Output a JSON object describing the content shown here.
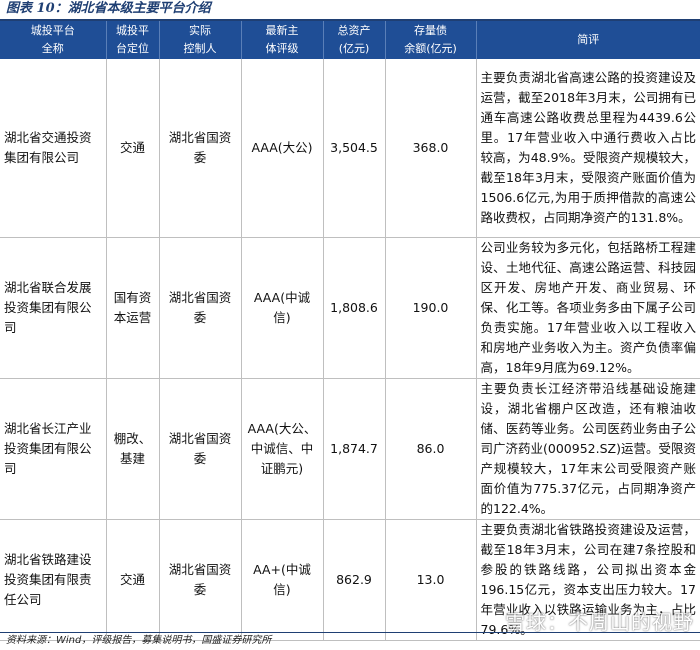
{
  "title": "图表 10：湖北省本级主要平台介绍",
  "headers": [
    "城投平台\n全称",
    "城投平\n台定位",
    "实际\n控制人",
    "最新主\n体评级",
    "总资产\n(亿元)",
    "存量债\n余额(亿元)",
    "简评"
  ],
  "rows": [
    {
      "name": "湖北省交通投资集团有限公司",
      "position": "交通",
      "controller": "湖北省国资委",
      "rating": "AAA(大公)",
      "assets": "3,504.5",
      "debt": "368.0",
      "note": "主要负责湖北省高速公路的投资建设及运营，截至2018年3月末，公司拥有已通车高速公路收费总里程为4439.6公里。17年营业收入中通行费收入占比较高，为48.9%。受限资产规模较大，截至18年3月末，受限资产账面价值为1506.6亿元,为用于质押借款的高速公路收费权，占同期净资产的131.8%。"
    },
    {
      "name": "湖北省联合发展投资集团有限公司",
      "position": "国有资本运营",
      "controller": "湖北省国资委",
      "rating": "AAA(中诚信)",
      "assets": "1,808.6",
      "debt": "190.0",
      "note": "公司业务较为多元化，包括路桥工程建设、土地代征、高速公路运营、科技园区开发、房地产开发、商业贸易、环保、化工等。各项业务多由下属子公司负责实施。17年营业收入以工程收入和房地产业务收入为主。资产负债率偏高，18年9月底为69.12%。"
    },
    {
      "name": "湖北省长江产业投资集团有限公司",
      "position": "棚改、基建",
      "controller": "湖北省国资委",
      "rating": "AAA(大公、中诚信、中证鹏元)",
      "assets": "1,874.7",
      "debt": "86.0",
      "note": "主要负责长江经济带沿线基础设施建设，湖北省棚户区改造，还有粮油收储、医药等业务。公司医药业务由子公司广济药业(000952.SZ)运营。受限资产规模较大，17年末公司受限资产账面价值为775.37亿元，占同期净资产的122.4%。"
    },
    {
      "name": "湖北省铁路建设投资集团有限责任公司",
      "position": "交通",
      "controller": "湖北省国资委",
      "rating": "AA+(中诚信)",
      "assets": "862.9",
      "debt": "13.0",
      "note": "主要负责湖北省铁路投资建设及运营，截至18年3月末，公司在建7条控股和参股的铁路线路，公司拟出资本金196.15亿元，资本支出压力较大。17年营业收入以铁路运输业务为主，占比79.6%。"
    }
  ],
  "footer": "资料来源：Wind，评级报告，募集说明书，国盛证券研究所",
  "watermark": "雪球：不周山的视野",
  "colors": {
    "header_bg": "#1f4e96",
    "title": "#1f3f73"
  }
}
